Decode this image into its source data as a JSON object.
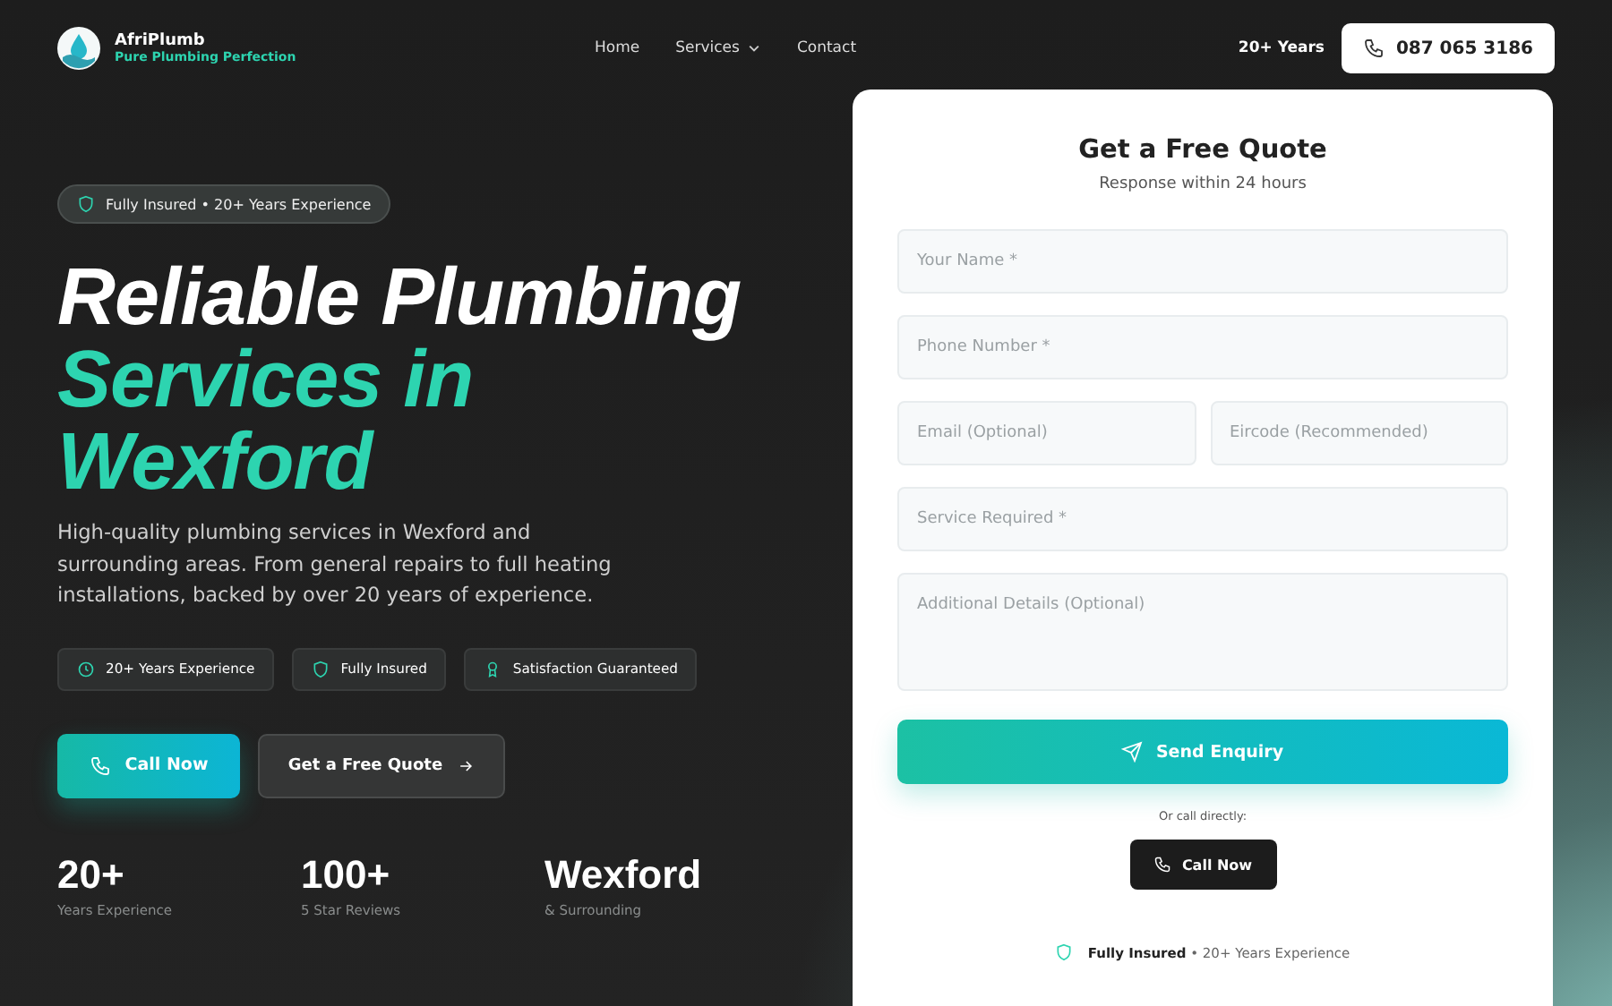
{
  "brand": {
    "name": "AfriPlumb",
    "tagline": "Pure Plumbing Perfection"
  },
  "nav": [
    {
      "label": "Home",
      "dropdown": false
    },
    {
      "label": "Services",
      "dropdown": true
    },
    {
      "label": "Contact",
      "dropdown": false
    }
  ],
  "header_note": "20+ Years",
  "phone_button": "087 065 3186",
  "hero": {
    "badge": "Fully Insured • 20+ Years Experience",
    "title_lines": [
      {
        "text": "Reliable Plumbing",
        "accent": false
      },
      {
        "text": "Services in",
        "accent": true
      },
      {
        "text": "Wexford",
        "accent": true
      }
    ],
    "description": "High-quality plumbing services in Wexford and surrounding areas. From general repairs to full heating installations, backed by over 20 years of experience.",
    "features": [
      {
        "kind": "clock",
        "label": "20+ Years Experience"
      },
      {
        "kind": "shield",
        "label": "Fully Insured"
      },
      {
        "kind": "award",
        "label": "Satisfaction Guaranteed"
      }
    ],
    "primary_button": "Call Now",
    "secondary_button": "Get a Free Quote",
    "stats": [
      {
        "value": "20+",
        "label": "Years Experience"
      },
      {
        "value": "100+",
        "label": "5 Star Reviews"
      },
      {
        "value": "Wexford",
        "label": "& Surrounding"
      }
    ]
  },
  "quote_form": {
    "title": "Get a Free Quote",
    "subtitle": "Response within 24 hours",
    "rows": [
      [
        {
          "kind": "input",
          "placeholder": "Your Name *"
        }
      ],
      [
        {
          "kind": "input",
          "placeholder": "Phone Number *"
        }
      ],
      [
        {
          "kind": "input",
          "placeholder": "Email (Optional)"
        },
        {
          "kind": "input",
          "placeholder": "Eircode (Recommended)"
        }
      ],
      [
        {
          "kind": "input",
          "placeholder": "Service Required *"
        }
      ],
      [
        {
          "kind": "textarea",
          "placeholder": "Additional Details (Optional)"
        }
      ]
    ],
    "submit": "Send Enquiry",
    "alt_text": "Or call directly:",
    "call_button": "Call Now",
    "footer": "**Fully Insured** • 20+ Years Experience"
  }
}
